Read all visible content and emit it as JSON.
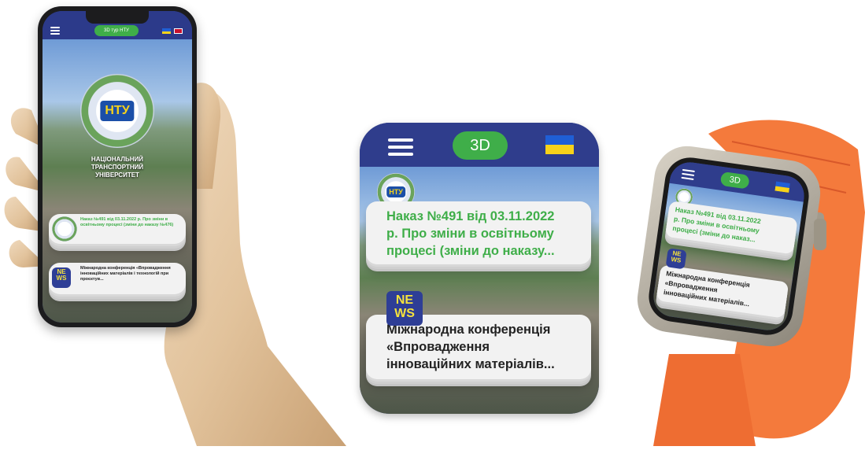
{
  "phone": {
    "tour_button": "3D тур НТУ",
    "university_name_lines": [
      "НАЦІОНАЛЬНИЙ",
      "ТРАНСПОРТНИЙ",
      "УНІВЕРСИТЕТ"
    ],
    "logo_text": "НТУ",
    "card1_text": "Наказ №491 від 03.11.2022 р. Про зміни в освітньому процесі (зміни до наказу №476)",
    "news_badge": [
      "NE",
      "WS"
    ],
    "card2_text": "Міжнародна конференція «Впровадження інноваційних матеріалів і технологій при проєктув..."
  },
  "square": {
    "tour_button": "3D",
    "logo_text": "НТУ",
    "card1_lines": [
      "Наказ №491 від 03.11.2022",
      "р. Про зміни в освітньому",
      "процесі (зміни до наказу..."
    ],
    "news_badge": [
      "NE",
      "WS"
    ],
    "card2_lines": [
      "Міжнародна конференція",
      "«Впровадження",
      "інноваційних матеріалів..."
    ]
  },
  "watch": {
    "tour_button": "3D",
    "card1_lines": [
      "Наказ №491 від 03.11.2022",
      "р. Про зміни в освітньому",
      "процесі (зміни до наказ..."
    ],
    "news_badge": [
      "NE",
      "WS"
    ],
    "card2_lines": [
      "Міжнародна конференція",
      "«Впровадження",
      "інноваційних матеріалів..."
    ]
  },
  "colors": {
    "accent_green": "#3fae49",
    "header_blue": "#2c3a8a",
    "news_blue": "#2e3e96",
    "strap_orange": "#f47a3c"
  }
}
